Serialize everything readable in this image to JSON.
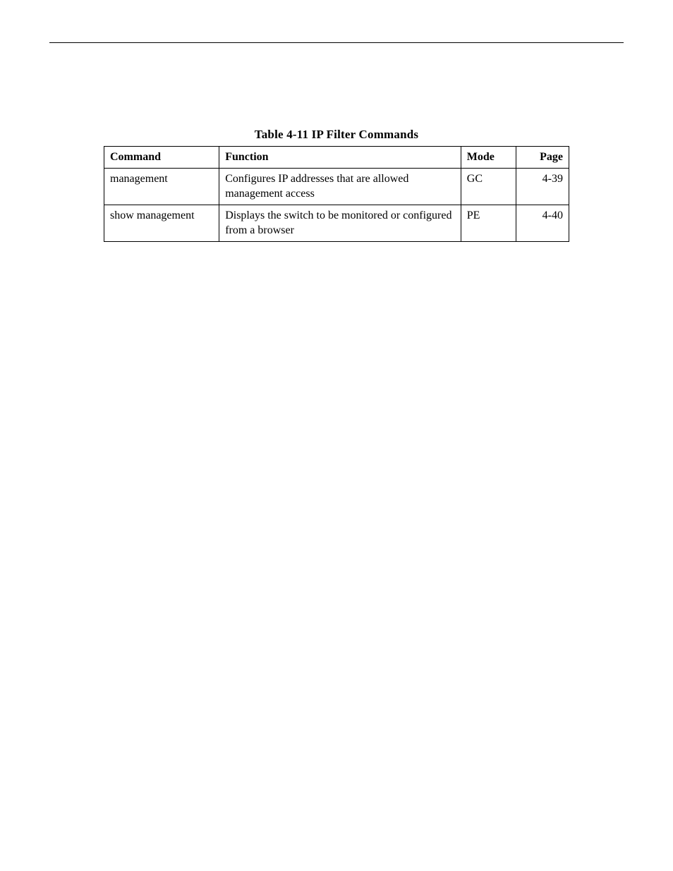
{
  "table": {
    "caption": "Table 4-11  IP Filter Commands",
    "headers": {
      "command": "Command",
      "function": "Function",
      "mode": "Mode",
      "page": "Page"
    },
    "rows": [
      {
        "command": "management",
        "function": "Configures IP addresses that are allowed management access",
        "mode": "GC",
        "page": "4-39"
      },
      {
        "command": "show management",
        "function": "Displays the switch to be monitored or configured from a browser",
        "mode": "PE",
        "page": "4-40"
      }
    ]
  }
}
